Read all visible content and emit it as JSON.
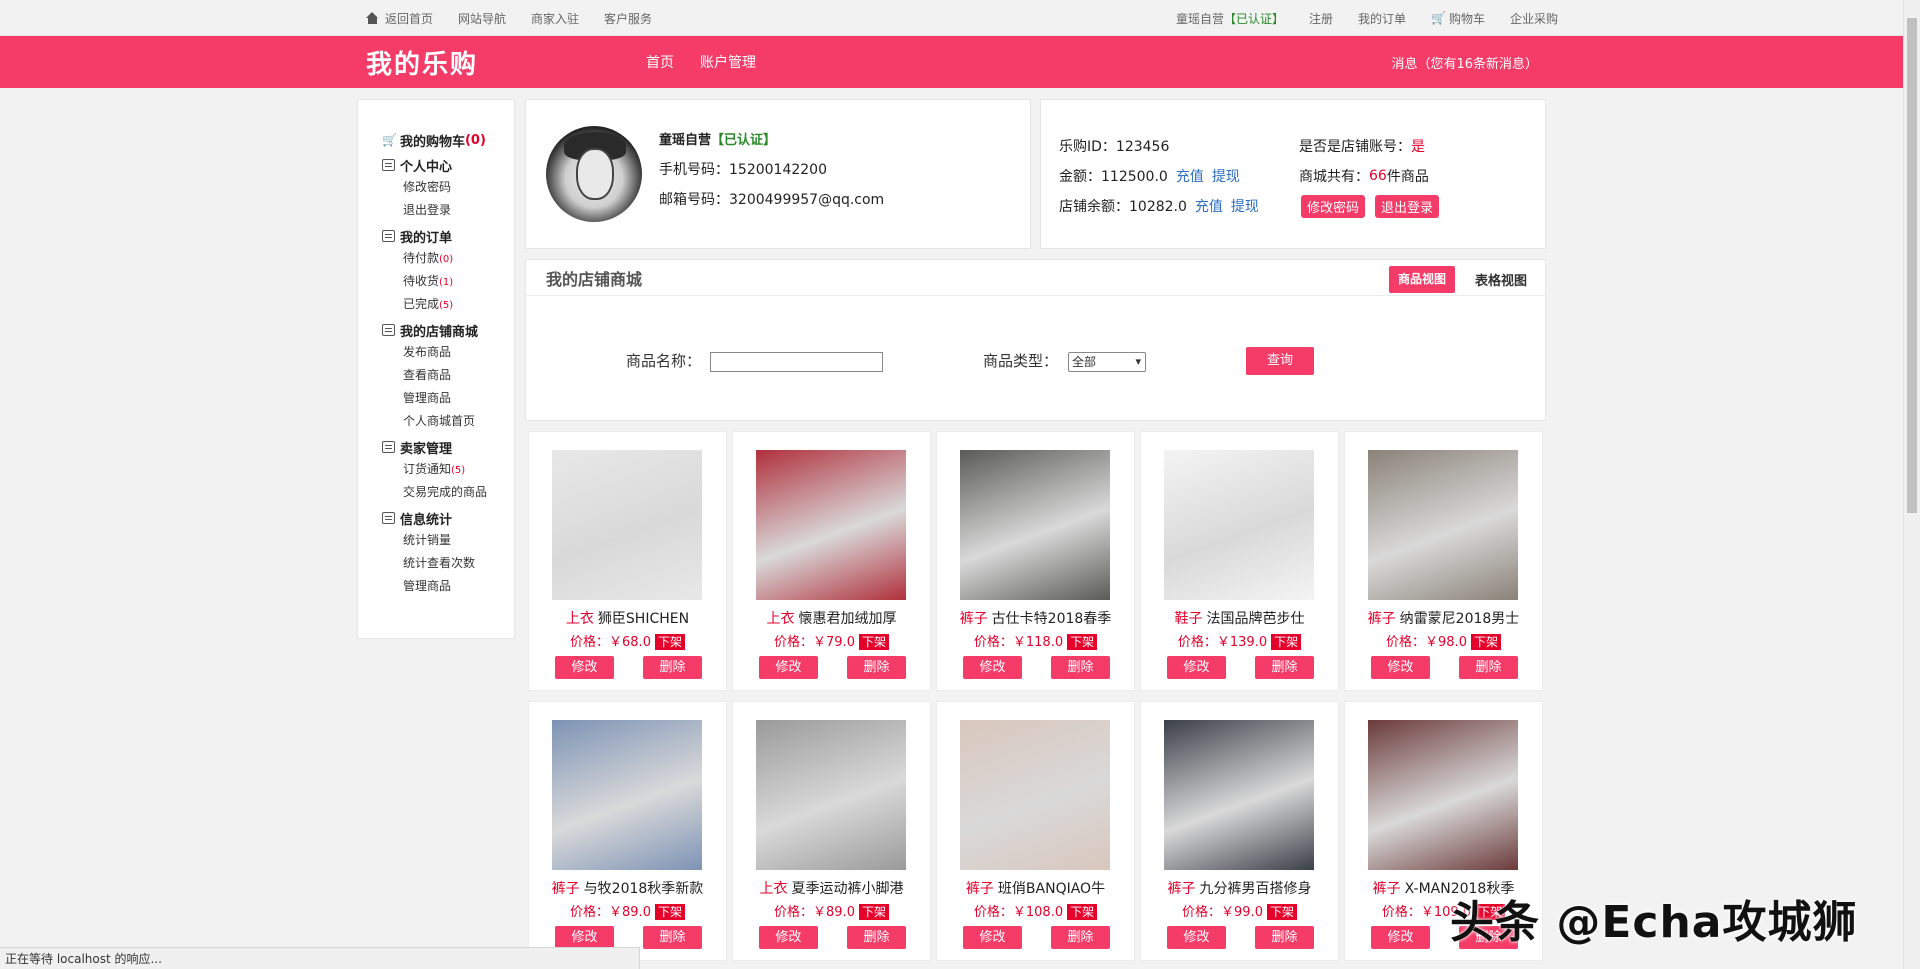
{
  "topbar": {
    "left": [
      "返回首页",
      "网站导航",
      "商家入驻",
      "客户服务"
    ],
    "shop_name": "童瑶自营",
    "verified": "【已认证】",
    "right": [
      "注册",
      "我的订单",
      "购物车",
      "企业采购"
    ]
  },
  "header": {
    "logo": "我的乐购",
    "nav": [
      "首页",
      "账户管理"
    ],
    "messages": "消息（您有16条新消息）"
  },
  "sidebar": {
    "cart": "我的购物车",
    "cart_count": "(0)",
    "groups": [
      {
        "title": "个人中心",
        "items": [
          {
            "label": "修改密码"
          },
          {
            "label": "退出登录"
          }
        ]
      },
      {
        "title": "我的订单",
        "items": [
          {
            "label": "待付款",
            "count": "(0)"
          },
          {
            "label": "待收货",
            "count": "(1)"
          },
          {
            "label": "已完成",
            "count": "(5)"
          }
        ]
      },
      {
        "title": "我的店铺商城",
        "items": [
          {
            "label": "发布商品"
          },
          {
            "label": "查看商品"
          },
          {
            "label": "管理商品"
          },
          {
            "label": "个人商城首页"
          }
        ]
      },
      {
        "title": "卖家管理",
        "items": [
          {
            "label": "订货通知",
            "count": "(5)"
          },
          {
            "label": "交易完成的商品"
          }
        ]
      },
      {
        "title": "信息统计",
        "items": [
          {
            "label": "统计销量"
          },
          {
            "label": "统计查看次数"
          },
          {
            "label": "管理商品"
          }
        ]
      }
    ]
  },
  "profile": {
    "name": "童瑶自营",
    "verified": "【已认证】",
    "phone": "手机号码：15200142200",
    "email": "邮箱号码：3200499957@qq.com"
  },
  "account": {
    "id": "乐购ID：123456",
    "balance": "金额：112500.0",
    "shop_balance": "店铺余额：10282.0",
    "recharge": "充值",
    "withdraw": "提现",
    "is_shop_label": "是否是店铺账号：",
    "is_shop_value": "是",
    "mall_pre": "商城共有：",
    "mall_count": "66",
    "mall_post": " 件商品",
    "change_pwd": "修改密码",
    "logout": "退出登录"
  },
  "shop": {
    "title": "我的店铺商城",
    "view_goods": "商品视图",
    "view_table": "表格视图",
    "name_label": "商品名称：",
    "name_value": "",
    "type_label": "商品类型：",
    "type_value": "全部",
    "query": "查询"
  },
  "products": [
    {
      "cat": "上衣",
      "name": "狮臣SHICHEN",
      "price": "价格：￥68.0",
      "color": "#e8e8e8"
    },
    {
      "cat": "上衣",
      "name": "懐惠君加绒加厚",
      "price": "价格：￥79.0",
      "color": "#b0303c"
    },
    {
      "cat": "裤子",
      "name": "古仕卡特2018春季",
      "price": "价格：￥118.0",
      "color": "#5a5a58"
    },
    {
      "cat": "鞋子",
      "name": "法国品牌芭步仕",
      "price": "价格：￥139.0",
      "color": "#f4f4f4"
    },
    {
      "cat": "裤子",
      "name": "纳雷蒙尼2018男士",
      "price": "价格：￥98.0",
      "color": "#8a8278"
    },
    {
      "cat": "裤子",
      "name": "与牧2018秋季新款",
      "price": "价格：￥89.0",
      "color": "#7d93b5"
    },
    {
      "cat": "上衣",
      "name": "夏季运动裤小脚港",
      "price": "价格：￥89.0",
      "color": "#9a9a9a"
    },
    {
      "cat": "裤子",
      "name": "班俏BANQIAO牛",
      "price": "价格：￥108.0",
      "color": "#d9c7bd"
    },
    {
      "cat": "裤子",
      "name": "九分裤男百搭修身",
      "price": "价格：￥99.0",
      "color": "#3b3f48"
    },
    {
      "cat": "裤子",
      "name": "X-MAN2018秋季",
      "price": "价格：￥109.0",
      "color": "#6b3a3a"
    }
  ],
  "product_actions": {
    "off": "下架",
    "edit": "修改",
    "delete": "删除"
  },
  "status_text": "正在等待 localhost 的响应...",
  "watermark": "头条 @Echa攻城狮"
}
